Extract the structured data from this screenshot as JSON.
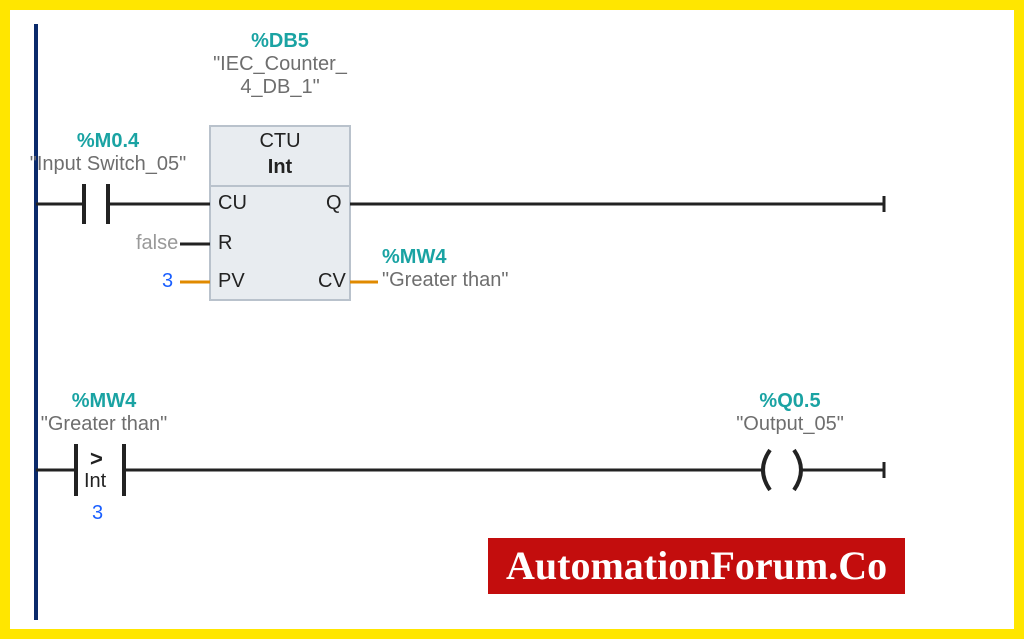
{
  "network1": {
    "input": {
      "address": "%M0.4",
      "symbol": "\"Input Switch_05\""
    },
    "counter": {
      "db_address": "%DB5",
      "db_symbol_line1": "\"IEC_Counter_",
      "db_symbol_line2": "4_DB_1\"",
      "block_type": "CTU",
      "block_datatype": "Int",
      "pins": {
        "cu": "CU",
        "r": "R",
        "pv": "PV",
        "q": "Q",
        "cv": "CV"
      },
      "r_value": "false",
      "pv_value": "3",
      "cv_out": {
        "address": "%MW4",
        "symbol": "\"Greater than\""
      }
    }
  },
  "network2": {
    "compare": {
      "address": "%MW4",
      "symbol": "\"Greater than\"",
      "op": ">",
      "datatype": "Int",
      "operand2": "3"
    },
    "output": {
      "address": "%Q0.5",
      "symbol": "\"Output_05\""
    }
  },
  "watermark": "AutomationForum.Co"
}
